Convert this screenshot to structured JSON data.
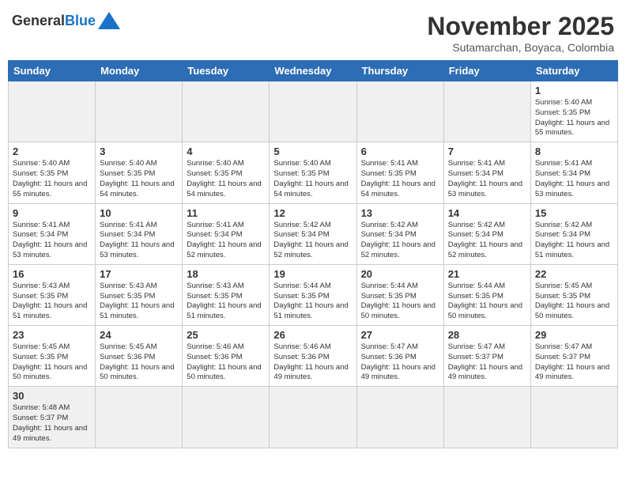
{
  "header": {
    "logo_general": "General",
    "logo_blue": "Blue",
    "month_title": "November 2025",
    "subtitle": "Sutamarchan, Boyaca, Colombia"
  },
  "weekdays": [
    "Sunday",
    "Monday",
    "Tuesday",
    "Wednesday",
    "Thursday",
    "Friday",
    "Saturday"
  ],
  "days": [
    {
      "num": "",
      "sunrise": "",
      "sunset": "",
      "daylight": "",
      "shaded": true
    },
    {
      "num": "",
      "sunrise": "",
      "sunset": "",
      "daylight": "",
      "shaded": true
    },
    {
      "num": "",
      "sunrise": "",
      "sunset": "",
      "daylight": "",
      "shaded": true
    },
    {
      "num": "",
      "sunrise": "",
      "sunset": "",
      "daylight": "",
      "shaded": true
    },
    {
      "num": "",
      "sunrise": "",
      "sunset": "",
      "daylight": "",
      "shaded": true
    },
    {
      "num": "",
      "sunrise": "",
      "sunset": "",
      "daylight": "",
      "shaded": true
    },
    {
      "num": "1",
      "sunrise": "Sunrise: 5:40 AM",
      "sunset": "Sunset: 5:35 PM",
      "daylight": "Daylight: 11 hours and 55 minutes.",
      "shaded": false
    },
    {
      "num": "2",
      "sunrise": "Sunrise: 5:40 AM",
      "sunset": "Sunset: 5:35 PM",
      "daylight": "Daylight: 11 hours and 55 minutes.",
      "shaded": false
    },
    {
      "num": "3",
      "sunrise": "Sunrise: 5:40 AM",
      "sunset": "Sunset: 5:35 PM",
      "daylight": "Daylight: 11 hours and 54 minutes.",
      "shaded": false
    },
    {
      "num": "4",
      "sunrise": "Sunrise: 5:40 AM",
      "sunset": "Sunset: 5:35 PM",
      "daylight": "Daylight: 11 hours and 54 minutes.",
      "shaded": false
    },
    {
      "num": "5",
      "sunrise": "Sunrise: 5:40 AM",
      "sunset": "Sunset: 5:35 PM",
      "daylight": "Daylight: 11 hours and 54 minutes.",
      "shaded": false
    },
    {
      "num": "6",
      "sunrise": "Sunrise: 5:41 AM",
      "sunset": "Sunset: 5:35 PM",
      "daylight": "Daylight: 11 hours and 54 minutes.",
      "shaded": false
    },
    {
      "num": "7",
      "sunrise": "Sunrise: 5:41 AM",
      "sunset": "Sunset: 5:34 PM",
      "daylight": "Daylight: 11 hours and 53 minutes.",
      "shaded": false
    },
    {
      "num": "8",
      "sunrise": "Sunrise: 5:41 AM",
      "sunset": "Sunset: 5:34 PM",
      "daylight": "Daylight: 11 hours and 53 minutes.",
      "shaded": false
    },
    {
      "num": "9",
      "sunrise": "Sunrise: 5:41 AM",
      "sunset": "Sunset: 5:34 PM",
      "daylight": "Daylight: 11 hours and 53 minutes.",
      "shaded": false
    },
    {
      "num": "10",
      "sunrise": "Sunrise: 5:41 AM",
      "sunset": "Sunset: 5:34 PM",
      "daylight": "Daylight: 11 hours and 53 minutes.",
      "shaded": false
    },
    {
      "num": "11",
      "sunrise": "Sunrise: 5:41 AM",
      "sunset": "Sunset: 5:34 PM",
      "daylight": "Daylight: 11 hours and 52 minutes.",
      "shaded": false
    },
    {
      "num": "12",
      "sunrise": "Sunrise: 5:42 AM",
      "sunset": "Sunset: 5:34 PM",
      "daylight": "Daylight: 11 hours and 52 minutes.",
      "shaded": false
    },
    {
      "num": "13",
      "sunrise": "Sunrise: 5:42 AM",
      "sunset": "Sunset: 5:34 PM",
      "daylight": "Daylight: 11 hours and 52 minutes.",
      "shaded": false
    },
    {
      "num": "14",
      "sunrise": "Sunrise: 5:42 AM",
      "sunset": "Sunset: 5:34 PM",
      "daylight": "Daylight: 11 hours and 52 minutes.",
      "shaded": false
    },
    {
      "num": "15",
      "sunrise": "Sunrise: 5:42 AM",
      "sunset": "Sunset: 5:34 PM",
      "daylight": "Daylight: 11 hours and 51 minutes.",
      "shaded": false
    },
    {
      "num": "16",
      "sunrise": "Sunrise: 5:43 AM",
      "sunset": "Sunset: 5:35 PM",
      "daylight": "Daylight: 11 hours and 51 minutes.",
      "shaded": false
    },
    {
      "num": "17",
      "sunrise": "Sunrise: 5:43 AM",
      "sunset": "Sunset: 5:35 PM",
      "daylight": "Daylight: 11 hours and 51 minutes.",
      "shaded": false
    },
    {
      "num": "18",
      "sunrise": "Sunrise: 5:43 AM",
      "sunset": "Sunset: 5:35 PM",
      "daylight": "Daylight: 11 hours and 51 minutes.",
      "shaded": false
    },
    {
      "num": "19",
      "sunrise": "Sunrise: 5:44 AM",
      "sunset": "Sunset: 5:35 PM",
      "daylight": "Daylight: 11 hours and 51 minutes.",
      "shaded": false
    },
    {
      "num": "20",
      "sunrise": "Sunrise: 5:44 AM",
      "sunset": "Sunset: 5:35 PM",
      "daylight": "Daylight: 11 hours and 50 minutes.",
      "shaded": false
    },
    {
      "num": "21",
      "sunrise": "Sunrise: 5:44 AM",
      "sunset": "Sunset: 5:35 PM",
      "daylight": "Daylight: 11 hours and 50 minutes.",
      "shaded": false
    },
    {
      "num": "22",
      "sunrise": "Sunrise: 5:45 AM",
      "sunset": "Sunset: 5:35 PM",
      "daylight": "Daylight: 11 hours and 50 minutes.",
      "shaded": false
    },
    {
      "num": "23",
      "sunrise": "Sunrise: 5:45 AM",
      "sunset": "Sunset: 5:35 PM",
      "daylight": "Daylight: 11 hours and 50 minutes.",
      "shaded": false
    },
    {
      "num": "24",
      "sunrise": "Sunrise: 5:45 AM",
      "sunset": "Sunset: 5:36 PM",
      "daylight": "Daylight: 11 hours and 50 minutes.",
      "shaded": false
    },
    {
      "num": "25",
      "sunrise": "Sunrise: 5:46 AM",
      "sunset": "Sunset: 5:36 PM",
      "daylight": "Daylight: 11 hours and 50 minutes.",
      "shaded": false
    },
    {
      "num": "26",
      "sunrise": "Sunrise: 5:46 AM",
      "sunset": "Sunset: 5:36 PM",
      "daylight": "Daylight: 11 hours and 49 minutes.",
      "shaded": false
    },
    {
      "num": "27",
      "sunrise": "Sunrise: 5:47 AM",
      "sunset": "Sunset: 5:36 PM",
      "daylight": "Daylight: 11 hours and 49 minutes.",
      "shaded": false
    },
    {
      "num": "28",
      "sunrise": "Sunrise: 5:47 AM",
      "sunset": "Sunset: 5:37 PM",
      "daylight": "Daylight: 11 hours and 49 minutes.",
      "shaded": false
    },
    {
      "num": "29",
      "sunrise": "Sunrise: 5:47 AM",
      "sunset": "Sunset: 5:37 PM",
      "daylight": "Daylight: 11 hours and 49 minutes.",
      "shaded": false
    },
    {
      "num": "30",
      "sunrise": "Sunrise: 5:48 AM",
      "sunset": "Sunset: 5:37 PM",
      "daylight": "Daylight: 11 hours and 49 minutes.",
      "shaded": false
    },
    {
      "num": "",
      "sunrise": "",
      "sunset": "",
      "daylight": "",
      "shaded": true
    },
    {
      "num": "",
      "sunrise": "",
      "sunset": "",
      "daylight": "",
      "shaded": true
    },
    {
      "num": "",
      "sunrise": "",
      "sunset": "",
      "daylight": "",
      "shaded": true
    },
    {
      "num": "",
      "sunrise": "",
      "sunset": "",
      "daylight": "",
      "shaded": true
    },
    {
      "num": "",
      "sunrise": "",
      "sunset": "",
      "daylight": "",
      "shaded": true
    },
    {
      "num": "",
      "sunrise": "",
      "sunset": "",
      "daylight": "",
      "shaded": true
    }
  ]
}
